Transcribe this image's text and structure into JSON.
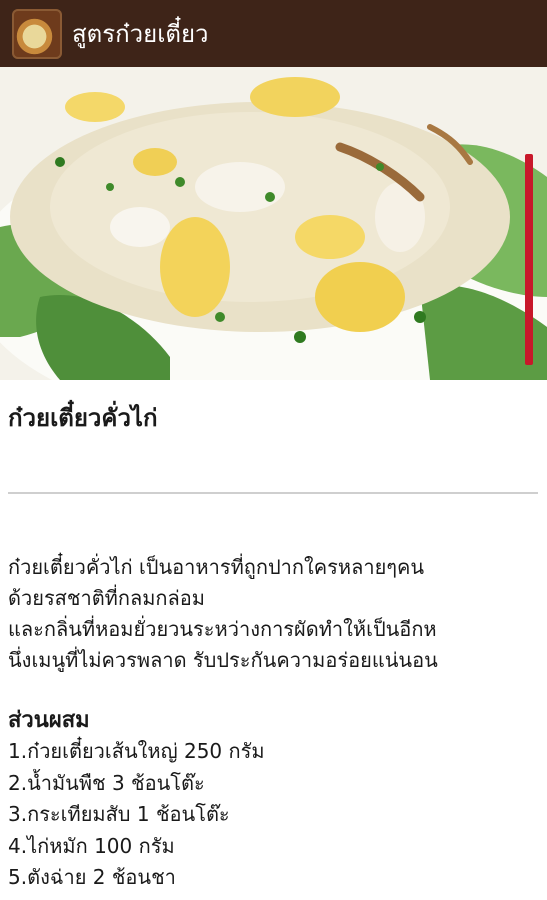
{
  "app": {
    "title": "สูตรก๋วยเตี๋ยว",
    "icon": "food-thumbnail-icon",
    "bar_color": "#3e2418"
  },
  "recipe": {
    "title": "ก๋วยเตี๋ยวคั่วไก่",
    "description_lines": [
      "ก๋วยเตี๋ยวคั่วไก่ เป็นอาหารที่ถูกปากใครหลายๆคน",
      "ด้วยรสชาติที่กลมกล่อม",
      "และกลิ่นที่หอมยั่วยวนระหว่างการผัดทำให้เป็นอีกห",
      "นึ่งเมนูที่ไม่ควรพลาด รับประกันความอร่อยแน่นอน"
    ],
    "ingredients_title": "ส่วนผสม",
    "ingredients": [
      "1.ก๋วยเตี๋ยวเส้นใหญ่ 250 กรัม",
      "2.น้ำมันพืช 3 ช้อนโต๊ะ",
      "3.กระเทียมสับ 1 ช้อนโต๊ะ",
      "4.ไก่หมัก 100 กรัม",
      "5.ตังฉ่าย 2 ช้อนชา"
    ]
  },
  "scrollbar_color": "#c8182a"
}
